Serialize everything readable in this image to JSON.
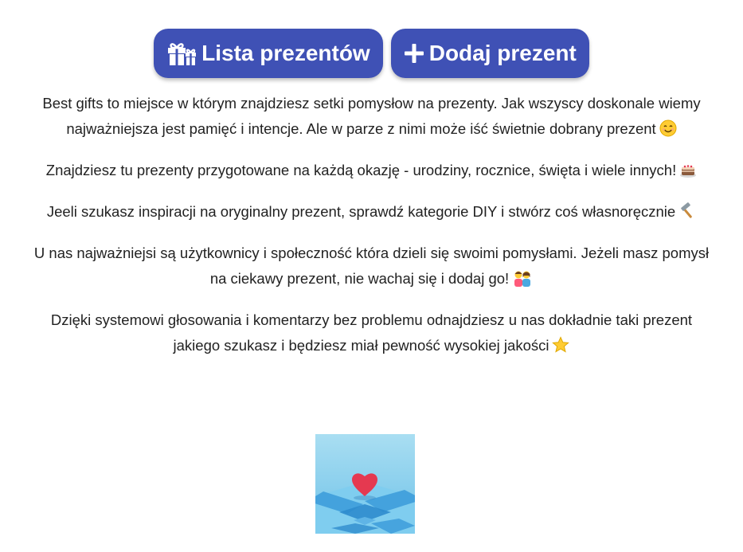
{
  "nav": {
    "gift_list_label": "Lista prezentów",
    "add_gift_label": "Dodaj prezent",
    "gift_icon": "gift-icon",
    "plus_icon": "plus-icon",
    "accent_color": "#3f51b5"
  },
  "intro": {
    "paragraphs": [
      {
        "text": "Best gifts to miejsce w którym znajdziesz setki pomysłow na prezenty. Jak wszyscy doskonale wiemy najważniejsza jest pamięć i intencje. Ale w parze z nimi może iść świetnie dobrany prezent",
        "emoji": "smiling-face-emoji"
      },
      {
        "text": "Znajdziesz tu prezenty przygotowane na każdą okazję - urodziny, rocznice, święta i wiele innych!",
        "emoji": "birthday-cake-emoji"
      },
      {
        "text": "Jeeli szukasz inspiracji na oryginalny prezent, sprawdź kategorie DIY i stwórz coś własnoręcznie",
        "emoji": "hammer-emoji"
      },
      {
        "text": "U nas najważniejsi są użytkownicy i społeczność która dzieli się swoimi pomysłami. Jeżeli masz pomysł na ciekawy prezent, nie wachaj się i dodaj go!",
        "emoji": "couple-emoji"
      },
      {
        "text": "Dzięki systemowi głosowania i komentarzy bez problemu odnajdziesz u nas dokładnie taki prezent jakiego szukasz i będziesz miał pewność wysokiej jakości",
        "emoji": "star-emoji"
      }
    ]
  },
  "illustration": {
    "name": "heart-on-blue-tiles-image",
    "colors": {
      "sky": "#8fd3ee",
      "tile": "#4aa8e0",
      "heart": "#e53950"
    }
  }
}
